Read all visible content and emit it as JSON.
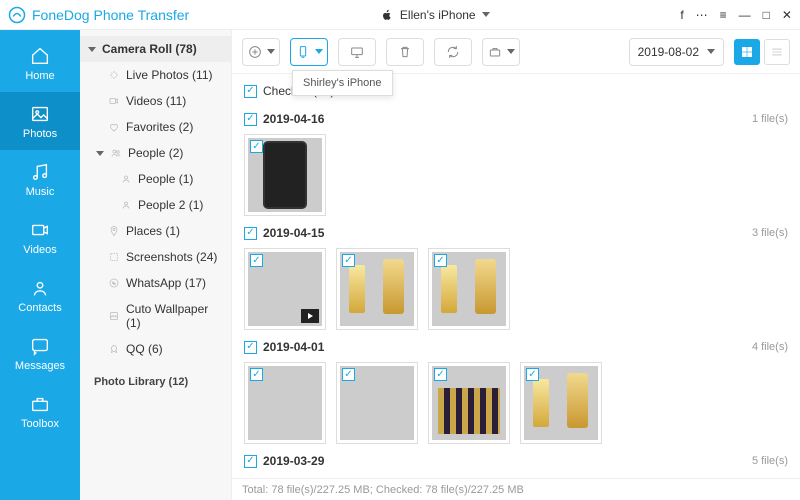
{
  "app": {
    "title": "FoneDog Phone Transfer"
  },
  "device": {
    "name": "Ellen's iPhone"
  },
  "nav": [
    {
      "label": "Home",
      "icon": "home"
    },
    {
      "label": "Photos",
      "icon": "photo"
    },
    {
      "label": "Music",
      "icon": "music"
    },
    {
      "label": "Videos",
      "icon": "video"
    },
    {
      "label": "Contacts",
      "icon": "contact"
    },
    {
      "label": "Messages",
      "icon": "message"
    },
    {
      "label": "Toolbox",
      "icon": "toolbox"
    }
  ],
  "nav_active": 1,
  "sidebar": {
    "head": "Camera Roll (78)",
    "items": [
      {
        "label": "Live Photos (11)",
        "icon": "sparkle",
        "indent": "sub"
      },
      {
        "label": "Videos (11)",
        "icon": "video",
        "indent": "sub"
      },
      {
        "label": "Favorites (2)",
        "icon": "heart",
        "indent": "sub"
      },
      {
        "label": "People (2)",
        "icon": "people",
        "indent": "sub",
        "expander": "down"
      },
      {
        "label": "People (1)",
        "icon": "person",
        "indent": "sub2"
      },
      {
        "label": "People 2 (1)",
        "icon": "person",
        "indent": "sub2"
      },
      {
        "label": "Places (1)",
        "icon": "pin",
        "indent": "sub"
      },
      {
        "label": "Screenshots (24)",
        "icon": "screenshot",
        "indent": "sub"
      },
      {
        "label": "WhatsApp (17)",
        "icon": "whatsapp",
        "indent": "sub"
      },
      {
        "label": "Cuto Wallpaper (1)",
        "icon": "wallpaper",
        "indent": "sub"
      },
      {
        "label": "QQ (6)",
        "icon": "qq",
        "indent": "sub"
      }
    ],
    "second_head": "Photo Library (12)"
  },
  "toolbar": {
    "tooltip": "Shirley's iPhone",
    "date_filter": "2019-08-02"
  },
  "checkall": {
    "label": "Check All(78)"
  },
  "groups": [
    {
      "date": "2019-04-16",
      "count": "1 file(s)",
      "thumbs": [
        {
          "cls": "p-phone"
        }
      ]
    },
    {
      "date": "2019-04-15",
      "count": "3 file(s)",
      "thumbs": [
        {
          "cls": "p-mug",
          "video": true
        },
        {
          "cls": "p-beer"
        },
        {
          "cls": "p-beer"
        }
      ]
    },
    {
      "date": "2019-04-01",
      "count": "4 file(s)",
      "thumbs": [
        {
          "cls": "p-dog1"
        },
        {
          "cls": "p-dog2"
        },
        {
          "cls": "p-city"
        },
        {
          "cls": "p-beer"
        }
      ]
    },
    {
      "date": "2019-03-29",
      "count": "5 file(s)",
      "thumbs": []
    }
  ],
  "status": "Total: 78 file(s)/227.25 MB; Checked: 78 file(s)/227.25 MB"
}
